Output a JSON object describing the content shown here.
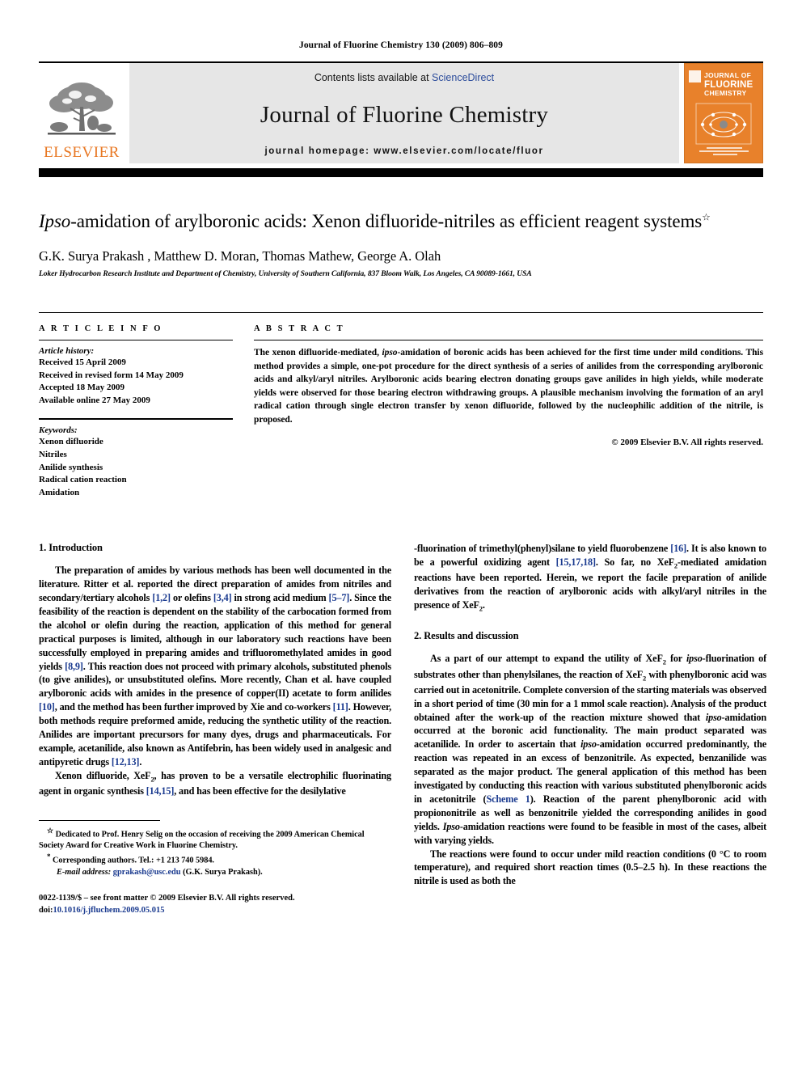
{
  "running_head": "Journal of Fluorine Chemistry 130 (2009) 806–809",
  "masthead": {
    "contents_prefix": "Contents lists available at ",
    "sciencedirect": "ScienceDirect",
    "journal_name": "Journal of Fluorine Chemistry",
    "homepage": "journal homepage: www.elsevier.com/locate/fluor",
    "publisher_wordmark": "ELSEVIER",
    "cover_line1": "JOURNAL OF",
    "cover_line2": "FLUORINE",
    "cover_line3": "CHEMISTRY"
  },
  "article": {
    "title_part1": "Ipso",
    "title_part2": "-amidation of arylboronic acids: Xenon difluoride-nitriles as efficient reagent systems",
    "title_footnote_mark": "☆",
    "authors": "G.K. Surya Prakash , Matthew D. Moran, Thomas Mathew, George A. Olah",
    "author_mark": "*",
    "affiliation": "Loker Hydrocarbon Research Institute and Department of Chemistry, University of Southern California, 837 Bloom Walk, Los Angeles, CA 90089-1661, USA"
  },
  "article_info": {
    "label": "A R T I C L E   I N F O",
    "history_heading": "Article history:",
    "history": [
      "Received 15 April 2009",
      "Received in revised form 14 May 2009",
      "Accepted 18 May 2009",
      "Available online 27 May 2009"
    ],
    "keywords_heading": "Keywords:",
    "keywords": [
      "Xenon difluoride",
      "Nitriles",
      "Anilide synthesis",
      "Radical cation reaction",
      "Amidation"
    ]
  },
  "abstract": {
    "label": "A B S T R A C T",
    "text_a": "The xenon difluoride-mediated, ",
    "text_ipso": "ipso",
    "text_b": "-amidation of boronic acids has been achieved for the first time under mild conditions. This method provides a simple, one-pot procedure for the direct synthesis of a series of anilides from the corresponding arylboronic acids and alkyl/aryl nitriles. Arylboronic acids bearing electron donating groups gave anilides in high yields, while moderate yields were observed for those bearing electron withdrawing groups. A plausible mechanism involving the formation of an aryl radical cation through single electron transfer by xenon difluoride, followed by the nucleophilic addition of the nitrile, is proposed.",
    "copyright": "© 2009 Elsevier B.V. All rights reserved."
  },
  "sections": {
    "introduction_heading": "1. Introduction",
    "results_heading": "2. Results and discussion"
  },
  "body": {
    "intro_p1_a": "The preparation of amides by various methods has been well documented in the literature. Ritter et al. reported the direct preparation of amides from nitriles and secondary/tertiary alcohols ",
    "intro_p1_ref1": "[1,2]",
    "intro_p1_b": " or olefins ",
    "intro_p1_ref2": "[3,4]",
    "intro_p1_c": " in strong acid medium ",
    "intro_p1_ref3": "[5–7]",
    "intro_p1_d": ". Since the feasibility of the reaction is dependent on the stability of the carbocation formed from the alcohol or olefin during the reaction, application of this method for general practical purposes is limited, although in our laboratory such reactions have been successfully employed in preparing amides and trifluoromethylated amides in good yields ",
    "intro_p1_ref4": "[8,9]",
    "intro_p1_e": ". This reaction does not proceed with primary alcohols, substituted phenols (to give anilides), or unsubstituted olefins. More recently, Chan et al. have coupled arylboronic acids with amides in the presence of copper(II) acetate to form anilides ",
    "intro_p1_ref5": "[10]",
    "intro_p1_f": ", and the method has been further improved by Xie and co-workers ",
    "intro_p1_ref6": "[11]",
    "intro_p1_g": ". However, both methods require preformed amide, reducing the synthetic utility of the reaction. Anilides are important precursors for many dyes, drugs and pharmaceuticals. For example, acetanilide, also known as Antifebrin, has been widely used in analgesic and antipyretic drugs ",
    "intro_p1_ref7": "[12,13]",
    "intro_p1_h": ".",
    "intro_p2_a": "Xenon difluoride, XeF",
    "intro_p2_sub": "2",
    "intro_p2_b": ", has proven to be a versatile electrophilic fluorinating agent in organic synthesis ",
    "intro_p2_ref1": "[14,15]",
    "intro_p2_c": ", and has been effective for the desilylative ",
    "intro_p2_ipso": "ipso",
    "intro_p2_d": "-fluorination of trimethyl(phenyl)silane to yield fluorobenzene ",
    "intro_p2_ref2": "[16]",
    "intro_p2_e": ". It is also known to be a powerful oxidizing agent ",
    "intro_p2_ref3": "[15,17,18]",
    "intro_p2_f": ". So far, no XeF",
    "intro_p2_sub2": "2",
    "intro_p2_g": "-mediated amidation reactions have been reported. Herein, we report the facile preparation of anilide derivatives from the reaction of arylboronic acids with alkyl/aryl nitriles in the presence of XeF",
    "intro_p2_sub3": "2",
    "intro_p2_h": ".",
    "results_p1_a": "As a part of our attempt to expand the utility of XeF",
    "results_p1_sub1": "2",
    "results_p1_b": " for ",
    "results_p1_ipso1": "ipso",
    "results_p1_c": "-fluorination of substrates other than phenylsilanes, the reaction of XeF",
    "results_p1_sub2": "2",
    "results_p1_d": " with phenylboronic acid was carried out in acetonitrile. Complete conversion of the starting materials was observed in a short period of time (30 min for a 1 mmol scale reaction). Analysis of the product obtained after the work-up of the reaction mixture showed that ",
    "results_p1_ipso2": "ipso",
    "results_p1_e": "-amidation occurred at the boronic acid functionality. The main product separated was acetanilide. In order to ascertain that ",
    "results_p1_ipso3": "ipso",
    "results_p1_f": "-amidation occurred predominantly, the reaction was repeated in an excess of benzonitrile. As expected, benzanilide was separated as the major product. The general application of this method has been investigated by conducting this reaction with various substituted phenylboronic acids in acetonitrile (",
    "results_p1_scheme": "Scheme 1",
    "results_p1_g": "). Reaction of the parent phenylboronic acid with propiononitrile as well as benzonitrile yielded the corresponding anilides in good yields. ",
    "results_p1_ipso4": "Ipso",
    "results_p1_h": "-amidation reactions were found to be feasible in most of the cases, albeit with varying yields.",
    "results_p2": "The reactions were found to occur under mild reaction conditions (0 °C to room temperature), and required short reaction times (0.5–2.5 h). In these reactions the nitrile is used as both the"
  },
  "footnotes": {
    "dedication_mark": "☆",
    "dedication": "Dedicated to Prof. Henry Selig on the occasion of receiving the 2009 American Chemical Society Award for Creative Work in Fluorine Chemistry.",
    "corresponding_mark": "*",
    "corresponding": "Corresponding authors. Tel.: +1 213 740 5984.",
    "email_label": "E-mail address:",
    "email": "gprakash@usc.edu",
    "email_owner": "(G.K. Surya Prakash).",
    "imprint": "0022-1139/$ – see front matter © 2009 Elsevier B.V. All rights reserved.",
    "doi_label": "doi:",
    "doi": "10.1016/j.jfluchem.2009.05.015"
  },
  "colors": {
    "link": "#1a3a8f",
    "elsevier_orange": "#e87722",
    "masthead_gray": "#e6e6e6"
  }
}
